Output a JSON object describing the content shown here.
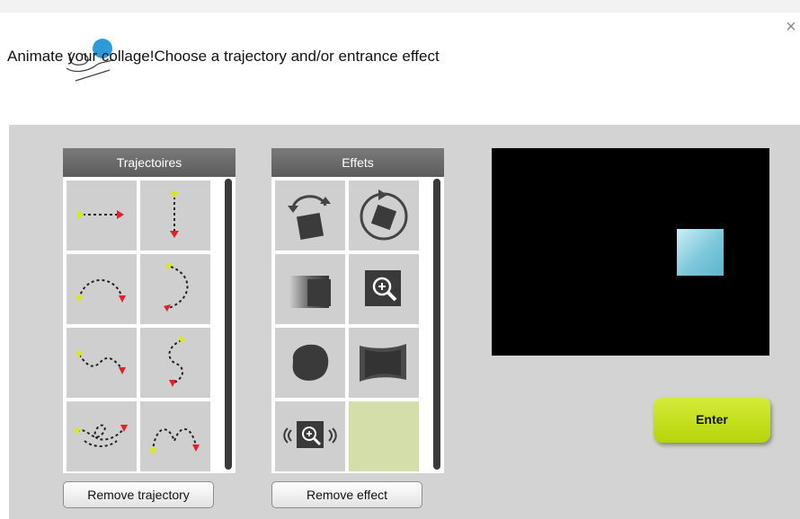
{
  "header": {
    "text": "Animate your collage!Choose a trajectory and/or entrance effect",
    "close_glyph": "×"
  },
  "trajectories": {
    "title": "Trajectoires",
    "items": [
      {
        "icon": "horizontal-arrow-trajectory-icon"
      },
      {
        "icon": "vertical-arrow-trajectory-icon"
      },
      {
        "icon": "arc-trajectory-icon"
      },
      {
        "icon": "curve-trajectory-icon"
      },
      {
        "icon": "wave-trajectory-icon"
      },
      {
        "icon": "s-curve-trajectory-icon"
      },
      {
        "icon": "loop-trajectory-icon"
      },
      {
        "icon": "bounce-trajectory-icon"
      }
    ],
    "remove_label": "Remove trajectory"
  },
  "effects": {
    "title": "Effets",
    "items": [
      {
        "icon": "flip-effect-icon"
      },
      {
        "icon": "rotate-effect-icon"
      },
      {
        "icon": "blur-box-effect-icon"
      },
      {
        "icon": "zoom-in-effect-icon"
      },
      {
        "icon": "circle-morph-effect-icon"
      },
      {
        "icon": "distort-effect-icon"
      },
      {
        "icon": "zoom-shake-effect-icon"
      },
      {
        "icon": "none-effect-cell",
        "selected": true
      }
    ],
    "remove_label": "Remove effect"
  },
  "preview": {
    "object_color": "#7cc7da"
  },
  "enter": {
    "label": "Enter",
    "color": "#c4e01c"
  },
  "colors": {
    "arrow_start": "#d7e81c",
    "arrow_end": "#e0202c",
    "selected_cell": "#d4deaa",
    "panel_header": "#6a6a6a"
  }
}
